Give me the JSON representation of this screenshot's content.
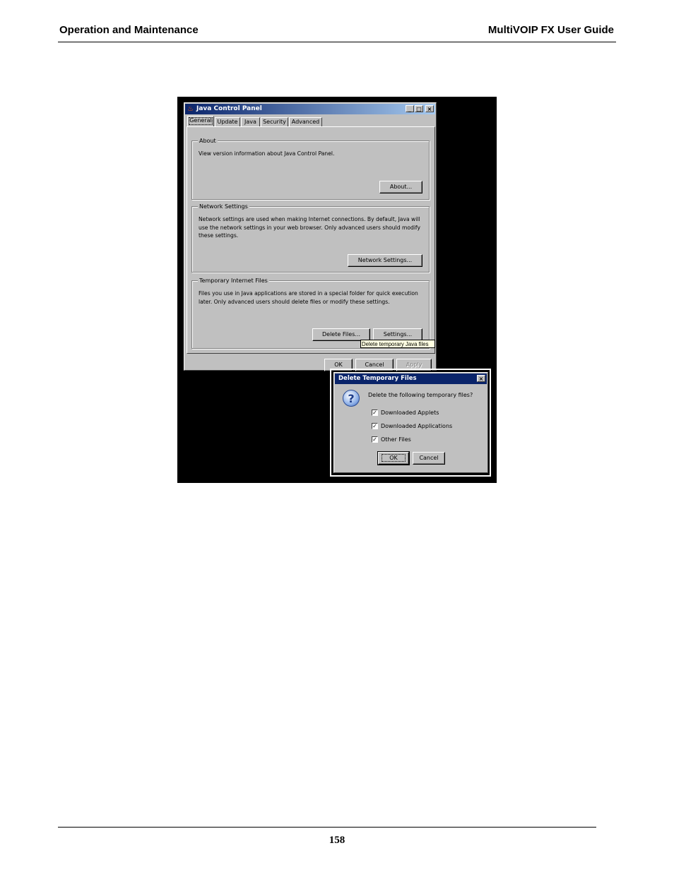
{
  "header": {
    "left": "Operation and Maintenance",
    "right": "MultiVOIP FX User Guide"
  },
  "footer": {
    "page_number": "158"
  },
  "java_control_panel": {
    "title": "Java Control Panel",
    "tabs": [
      "General",
      "Update",
      "Java",
      "Security",
      "Advanced"
    ],
    "active_tab": "General",
    "about": {
      "legend": "About",
      "text": "View version information about Java Control Panel.",
      "button": "About..."
    },
    "network": {
      "legend": "Network Settings",
      "text": "Network settings are used when making Internet connections.  By default, Java will use the network settings in your web browser.  Only advanced users should modify these settings.",
      "button": "Network Settings..."
    },
    "temp_files": {
      "legend": "Temporary Internet Files",
      "text": "Files you use in Java applications are stored in a special folder for quick execution later.  Only advanced users should delete files or modify these settings.",
      "delete_button": "Delete Files...",
      "settings_button": "Settings..."
    },
    "tooltip": "Delete temporary Java files",
    "footer_buttons": {
      "ok": "OK",
      "cancel": "Cancel",
      "apply": "Apply"
    }
  },
  "delete_dialog": {
    "title": "Delete Temporary Files",
    "question": "Delete the following temporary files?",
    "options": [
      {
        "label": "Downloaded Applets",
        "checked": true
      },
      {
        "label": "Downloaded Applications",
        "checked": true
      },
      {
        "label": "Other Files",
        "checked": true
      }
    ],
    "ok": "OK",
    "cancel": "Cancel"
  }
}
